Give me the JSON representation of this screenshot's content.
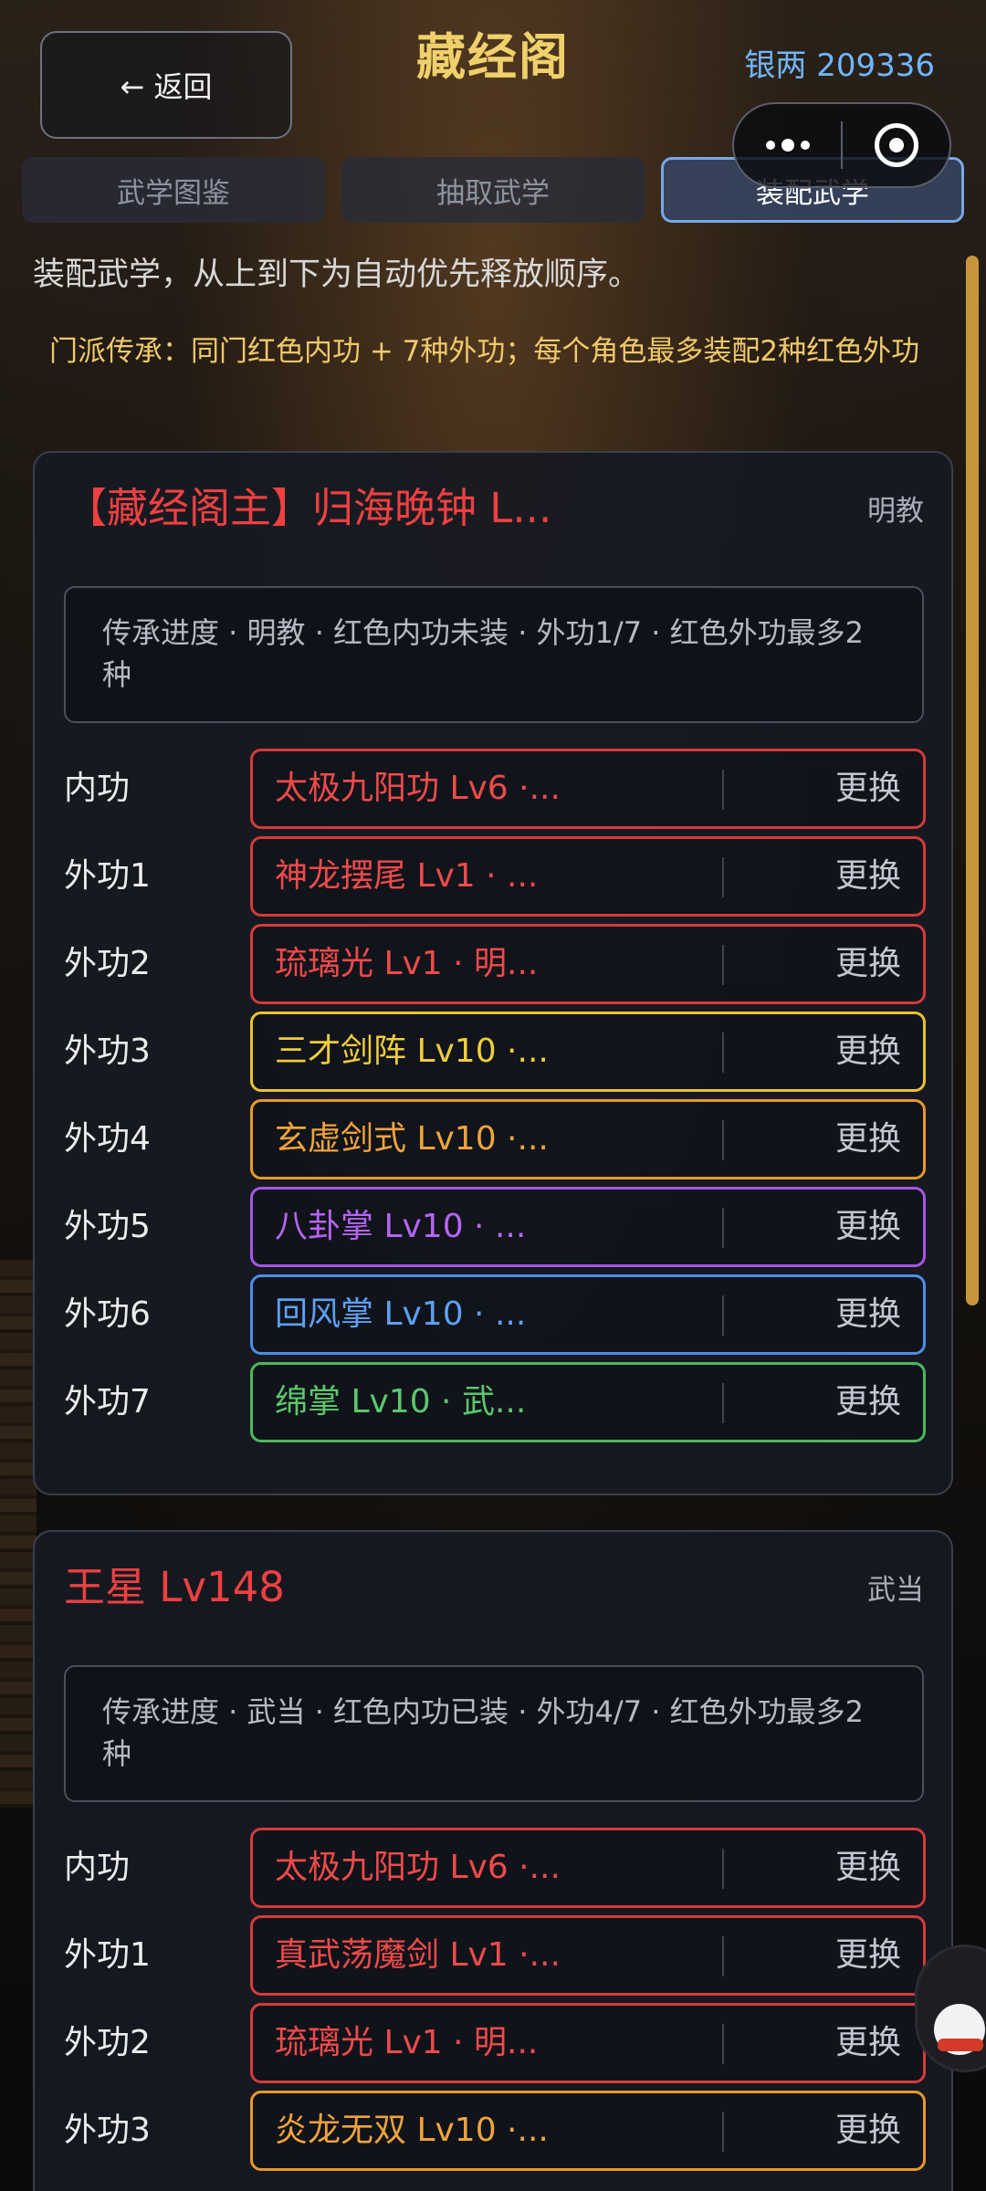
{
  "header": {
    "back_label": "← 返回",
    "title": "藏经阁",
    "silver_label": "银两",
    "silver_value": "209336"
  },
  "tabs": [
    {
      "label": "武学图鉴",
      "active": false
    },
    {
      "label": "抽取武学",
      "active": false
    },
    {
      "label": "装配武学",
      "active": true
    }
  ],
  "intro": "装配武学，从上到下为自动优先释放顺序。",
  "sect_note": "门派传承：同门红色内功 + 7种外功；每个角色最多装配2种红色外功",
  "swap_label": "更换",
  "colors": {
    "red": "#d63a3a",
    "yellow": "#e9c22c",
    "orange": "#e8982a",
    "purple": "#a955e8",
    "blue": "#4c8ee8",
    "green": "#4cb85c",
    "gold_title": "#f0d06a",
    "silver_blue": "#6fb6ff"
  },
  "characters": [
    {
      "name": "【藏经阁主】归海晚钟  L...",
      "sect": "明教",
      "progress": "传承进度 · 明教 · 红色内功未装 · 外功1/7 · 红色外功最多2种",
      "slots": [
        {
          "label": "内功",
          "skill": "太极九阳功  Lv6 ·...",
          "color": "red"
        },
        {
          "label": "外功1",
          "skill": "神龙摆尾  Lv1 · ...",
          "color": "red"
        },
        {
          "label": "外功2",
          "skill": "琉璃光  Lv1 · 明...",
          "color": "red"
        },
        {
          "label": "外功3",
          "skill": "三才剑阵  Lv10 ·...",
          "color": "yellow"
        },
        {
          "label": "外功4",
          "skill": "玄虚剑式  Lv10 ·...",
          "color": "orange"
        },
        {
          "label": "外功5",
          "skill": "八卦掌  Lv10 · ...",
          "color": "purple"
        },
        {
          "label": "外功6",
          "skill": "回风掌  Lv10 · ...",
          "color": "blue"
        },
        {
          "label": "外功7",
          "skill": "绵掌  Lv10 · 武...",
          "color": "green"
        }
      ]
    },
    {
      "name": "王星  Lv148",
      "sect": "武当",
      "progress": "传承进度 · 武当 · 红色内功已装 · 外功4/7 · 红色外功最多2种",
      "slots": [
        {
          "label": "内功",
          "skill": "太极九阳功  Lv6 ·...",
          "color": "red"
        },
        {
          "label": "外功1",
          "skill": "真武荡魔剑  Lv1 ·...",
          "color": "red"
        },
        {
          "label": "外功2",
          "skill": "琉璃光  Lv1 · 明...",
          "color": "red"
        },
        {
          "label": "外功3",
          "skill": "炎龙无双  Lv10 ·...",
          "color": "orange"
        }
      ]
    }
  ]
}
